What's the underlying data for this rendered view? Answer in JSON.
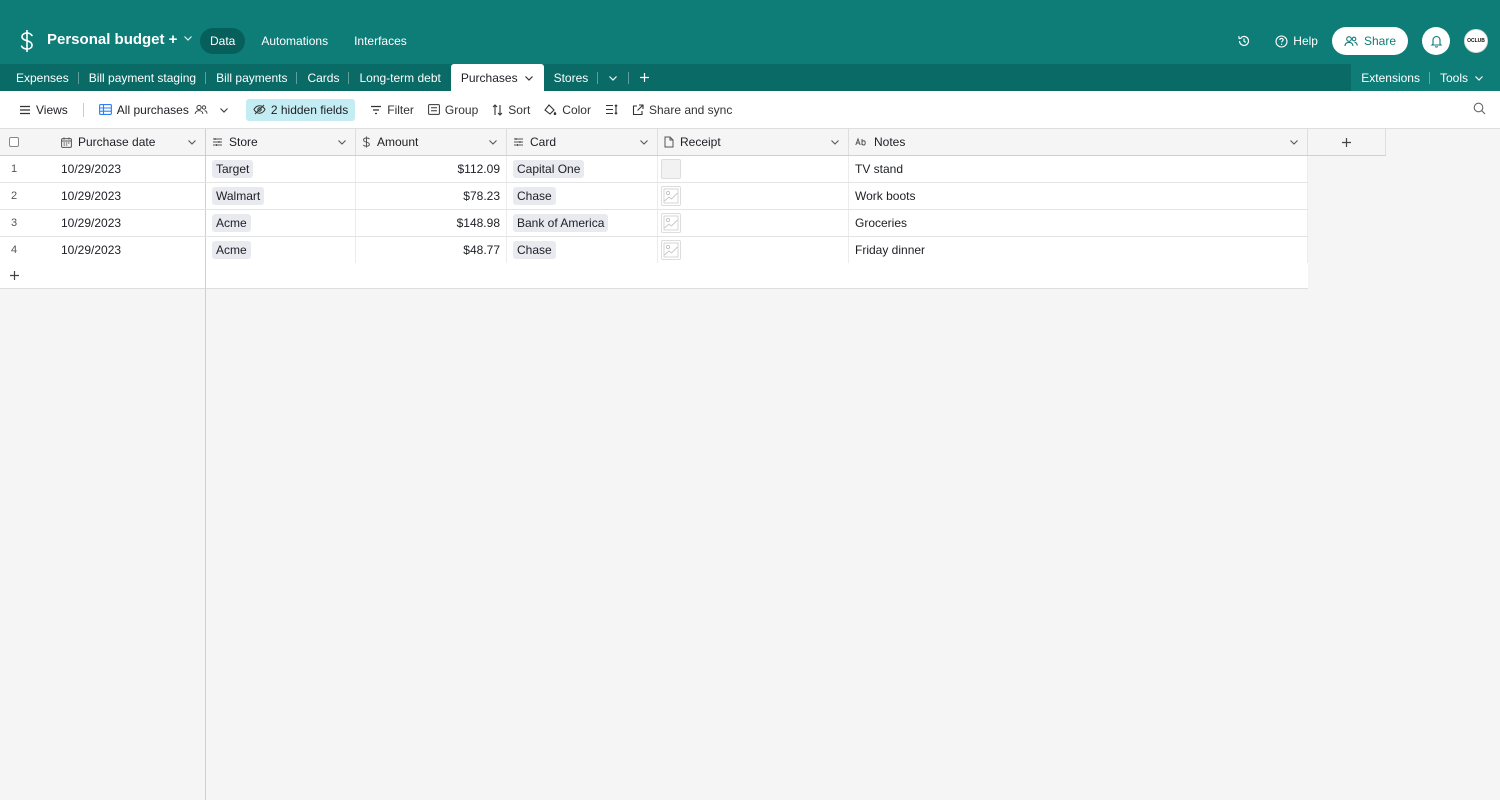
{
  "app": {
    "base_name": "Personal budget +",
    "nav": [
      {
        "label": "Data",
        "active": true
      },
      {
        "label": "Automations",
        "active": false
      },
      {
        "label": "Interfaces",
        "active": false
      }
    ],
    "help_label": "Help",
    "share_label": "Share",
    "avatar_text": "OCLUB"
  },
  "tables": {
    "tabs": [
      "Expenses",
      "Bill payment staging",
      "Bill payments",
      "Cards",
      "Long-term debt",
      "Purchases",
      "Stores"
    ],
    "active": "Purchases",
    "extensions_label": "Extensions",
    "tools_label": "Tools"
  },
  "toolbar": {
    "views_label": "Views",
    "view_name": "All purchases",
    "hidden_fields_label": "2 hidden fields",
    "filter_label": "Filter",
    "group_label": "Group",
    "sort_label": "Sort",
    "color_label": "Color",
    "share_sync_label": "Share and sync"
  },
  "grid": {
    "columns": [
      {
        "name": "Purchase date",
        "icon": "calendar-icon"
      },
      {
        "name": "Store",
        "icon": "link-icon"
      },
      {
        "name": "Amount",
        "icon": "currency-icon"
      },
      {
        "name": "Card",
        "icon": "link-icon"
      },
      {
        "name": "Receipt",
        "icon": "attachment-icon"
      },
      {
        "name": "Notes",
        "icon": "text-icon"
      }
    ],
    "rows": [
      {
        "num": "1",
        "date": "10/29/2023",
        "store": "Target",
        "amount": "$112.09",
        "card": "Capital One",
        "receipt": "empty",
        "notes": "TV stand"
      },
      {
        "num": "2",
        "date": "10/29/2023",
        "store": "Walmart",
        "amount": "$78.23",
        "card": "Chase",
        "receipt": "image",
        "notes": "Work boots"
      },
      {
        "num": "3",
        "date": "10/29/2023",
        "store": "Acme",
        "amount": "$148.98",
        "card": "Bank of America",
        "receipt": "image",
        "notes": "Groceries"
      },
      {
        "num": "4",
        "date": "10/29/2023",
        "store": "Acme",
        "amount": "$48.77",
        "card": "Chase",
        "receipt": "image",
        "notes": "Friday dinner"
      }
    ]
  },
  "colors": {
    "header_bg": "#0e7c77",
    "tabs_bg": "#0a6a66",
    "hidden_fields_bg": "#c4ecf3",
    "pill_bg": "#e8eaf0"
  }
}
